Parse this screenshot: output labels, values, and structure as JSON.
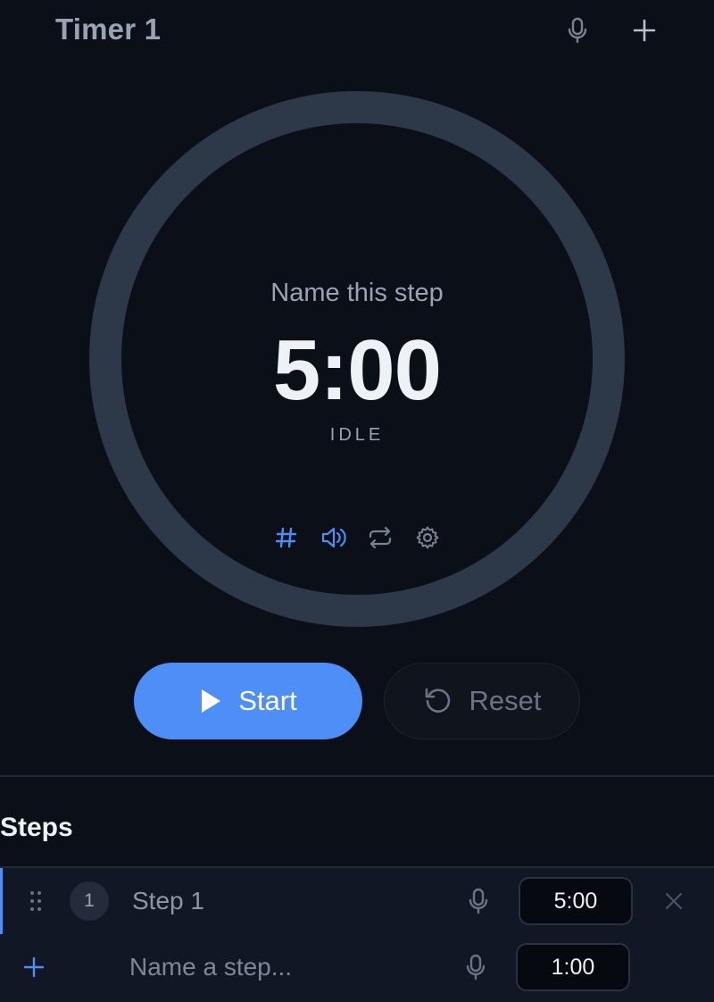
{
  "header": {
    "title": "Timer 1",
    "mic_icon": "microphone-icon",
    "add_icon": "plus-icon"
  },
  "timer": {
    "step_name": "Name this step",
    "time": "5:00",
    "status": "IDLE",
    "progress": 0,
    "ring_color": "#2d3849",
    "tools": [
      {
        "icon": "hash-icon",
        "active": true
      },
      {
        "icon": "speaker-icon",
        "active": true
      },
      {
        "icon": "repeat-icon",
        "active": false
      },
      {
        "icon": "gear-icon",
        "active": false
      }
    ]
  },
  "controls": {
    "start_label": "Start",
    "reset_label": "Reset"
  },
  "steps": {
    "title": "Steps",
    "items": [
      {
        "number": "1",
        "label": "Step 1",
        "duration": "5:00"
      }
    ],
    "new_step": {
      "placeholder": "Name a step...",
      "duration": "1:00"
    }
  },
  "colors": {
    "accent": "#4d8ef7",
    "background": "#0b0f17",
    "muted_text": "#9aa3b3"
  }
}
